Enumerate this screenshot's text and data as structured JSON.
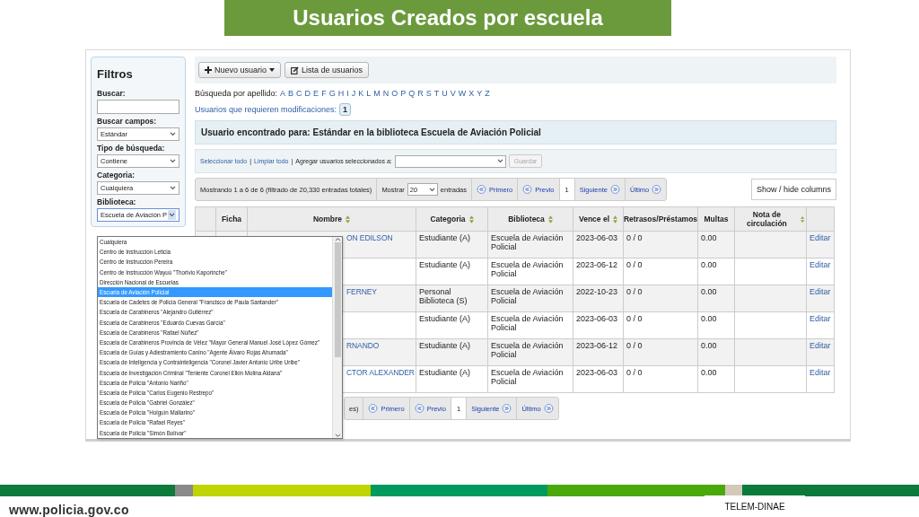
{
  "title": "Usuarios Creados por escuela",
  "sidebar": {
    "title": "Filtros",
    "fields": [
      {
        "label": "Buscar:",
        "kind": "text"
      },
      {
        "label": "Buscar campos:",
        "kind": "select",
        "value": "Estándar",
        "expanded": false
      },
      {
        "label": "Tipo de búsqueda:",
        "kind": "select",
        "value": "Contiene",
        "expanded": false
      },
      {
        "label": "Categoria:",
        "kind": "select",
        "value": "Cualquiera",
        "expanded": false
      },
      {
        "label": "Biblioteca:",
        "kind": "select",
        "value": "Escuela de Aviación P",
        "expanded": true
      }
    ]
  },
  "toolbar": {
    "buttons": [
      {
        "label": "Nuevo usuario",
        "kind": "menu"
      },
      {
        "label": "Lista de usuarios",
        "kind": "list"
      }
    ]
  },
  "surname_search": {
    "label": "Búsqueda por apellido:",
    "letters": [
      "A",
      "B",
      "C",
      "D",
      "E",
      "F",
      "G",
      "H",
      "I",
      "J",
      "K",
      "L",
      "M",
      "N",
      "O",
      "P",
      "Q",
      "R",
      "S",
      "T",
      "U",
      "V",
      "W",
      "X",
      "Y",
      "Z"
    ]
  },
  "modifications": {
    "label": "Usuarios que requieren modificaciones:",
    "count": "1"
  },
  "result_heading": "Usuario encontrado para: Estándar en la biblioteca Escuela de Aviación Policial",
  "selection_bar": {
    "links": [
      "Seleccionar todo",
      "Limpiar todo"
    ],
    "separator": "|",
    "add_label": "Agregar usuarios seleccionados a:",
    "save": {
      "label": "Guardar",
      "disabled": true
    }
  },
  "pager": {
    "summary": "Mostrando 1 a 6 de 6 (filtrado de 20,330 entradas totales)",
    "show_label": "Mostrar",
    "page_size": "20",
    "entries_label": "entradas",
    "first": "Primero",
    "prev": "Previo",
    "page": "1",
    "next": "Siguiente",
    "last": "Último"
  },
  "columns_button": "Show / hide columns",
  "table": {
    "columns": [
      {
        "label": "Ficha",
        "sortable": false
      },
      {
        "label": "Nombre",
        "sortable": true
      },
      {
        "label": "Categoria",
        "sortable": true
      },
      {
        "label": "Biblioteca",
        "sortable": true
      },
      {
        "label": "Vence el",
        "sortable": true
      },
      {
        "label": "Retrasos/Préstamos",
        "sortable": false
      },
      {
        "label": "Multas",
        "sortable": false
      },
      {
        "label": "Nota de circulación",
        "sortable": true
      }
    ],
    "rows": [
      {
        "name": "ON EDILSON",
        "category": "Estudiante (A)",
        "library": "Escuela de Aviación Policial",
        "expires": "2023-06-03",
        "checkouts": "0 / 0",
        "fines": "0.00",
        "action": "Editar"
      },
      {
        "category": "Estudiante (A)",
        "library": "Escuela de Aviación Policial",
        "expires": "2023-06-12",
        "checkouts": "0 / 0",
        "fines": "0.00",
        "action": "Editar"
      },
      {
        "name": "FERNEY",
        "category": "Personal Biblioteca (S)",
        "library": "Escuela de Aviación Policial",
        "expires": "2022-10-23",
        "checkouts": "0 / 0",
        "fines": "0.00",
        "action": "Editar"
      },
      {
        "category": "Estudiante (A)",
        "library": "Escuela de Aviación Policial",
        "expires": "2023-06-03",
        "checkouts": "0 / 0",
        "fines": "0.00",
        "action": "Editar"
      },
      {
        "name": "RNANDO",
        "category": "Estudiante (A)",
        "library": "Escuela de Aviación Policial",
        "expires": "2023-06-12",
        "checkouts": "0 / 0",
        "fines": "0.00",
        "action": "Editar"
      },
      {
        "name": "CTOR ALEXANDER",
        "category": "Estudiante (A)",
        "library": "Escuela de Aviación Policial",
        "expires": "2023-06-03",
        "checkouts": "0 / 0",
        "fines": "0.00",
        "action": "Editar"
      }
    ]
  },
  "bottom_pager": {
    "summary_tail": "es)",
    "first": "Primero",
    "prev": "Previo",
    "page": "1",
    "next": "Siguiente",
    "last": "Último"
  },
  "dropdown": {
    "options": [
      {
        "label": "Cualquiera",
        "selected": false
      },
      {
        "label": "Centro de Instrucción Leticia",
        "selected": false
      },
      {
        "label": "Centro de Instrucción Pereira",
        "selected": false
      },
      {
        "label": "Centro de Instrucción Wayuú \"Thorivio Kaporinche\"",
        "selected": false
      },
      {
        "label": "Dirección Nacional de Escuelas",
        "selected": false
      },
      {
        "label": "Escuela de Aviación Policial",
        "selected": true
      },
      {
        "label": "Escuela de Cadetes de Policía General \"Francisco de Paula Santander\"",
        "selected": false
      },
      {
        "label": "Escuela de Carabineros \"Alejandro Gutiérrez\"",
        "selected": false
      },
      {
        "label": "Escuela de Carabineros \"Eduardo Cuevas García\"",
        "selected": false
      },
      {
        "label": "Escuela de Carabineros \"Rafael Núñez\"",
        "selected": false
      },
      {
        "label": "Escuela de Carabineros Provincia de Vélez \"Mayor General Manuel José López Gómez\"",
        "selected": false
      },
      {
        "label": "Escuela de Guías y Adiestramiento Canino \"Agente Álvaro Rojas Ahumada\"",
        "selected": false
      },
      {
        "label": "Escuela de Inteligencia y Contrainteligencia \"Coronel Javier Antonio Uribe Uribe\"",
        "selected": false
      },
      {
        "label": "Escuela de Investigación Criminal \"Teniente Coronel Elkin Molina Aldana\"",
        "selected": false
      },
      {
        "label": "Escuela de Policía \"Antonio Nariño\"",
        "selected": false
      },
      {
        "label": "Escuela de Policía \"Carlos Eugenio Restrepo\"",
        "selected": false
      },
      {
        "label": "Escuela de Policía \"Gabriel González\"",
        "selected": false
      },
      {
        "label": "Escuela de Policía \"Holguín Mallarino\"",
        "selected": false
      },
      {
        "label": "Escuela de Policía \"Rafael Reyes\"",
        "selected": false
      },
      {
        "label": "Escuela de Policía \"Simón Bolívar\"",
        "selected": false
      }
    ]
  },
  "footer": {
    "site": "www.policia.gov.co",
    "tag": "TELEM-DINAE"
  }
}
